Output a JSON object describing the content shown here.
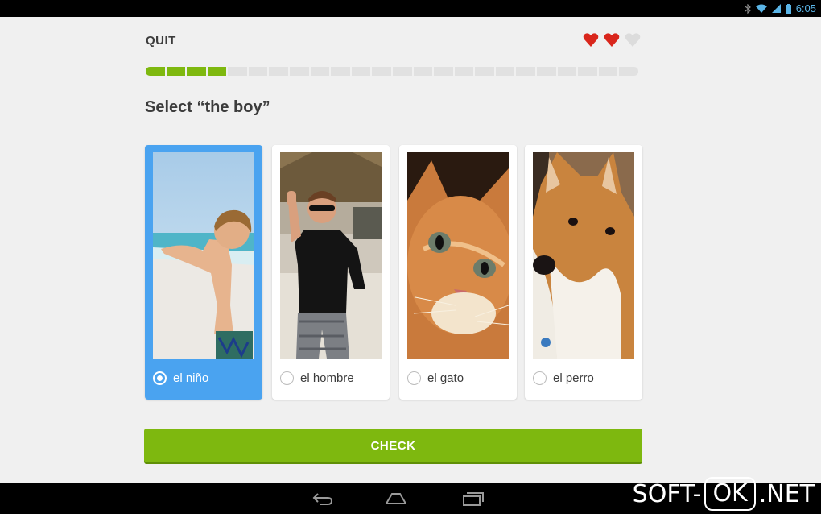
{
  "status_bar": {
    "time": "6:05"
  },
  "header": {
    "quit_label": "QUIT"
  },
  "hearts": [
    {
      "state": "full",
      "color": "#d9261c"
    },
    {
      "state": "full",
      "color": "#d9261c"
    },
    {
      "state": "empty",
      "color": "#dcdcdc"
    }
  ],
  "progress": {
    "completed_segments": 4,
    "total_segments": 24
  },
  "prompt": "Select “the boy”",
  "options": [
    {
      "label": "el niño",
      "image": "boy-photo",
      "selected": true
    },
    {
      "label": "el hombre",
      "image": "man-photo",
      "selected": false
    },
    {
      "label": "el gato",
      "image": "cat-photo",
      "selected": false
    },
    {
      "label": "el perro",
      "image": "dog-photo",
      "selected": false
    }
  ],
  "check_label": "CHECK",
  "watermark": {
    "left": "SOFT-",
    "boxed": "OK",
    "right": ".NET"
  },
  "colors": {
    "accent_green": "#7eb80f",
    "selected_blue": "#4aa3f0",
    "heart_red": "#d9261c"
  }
}
